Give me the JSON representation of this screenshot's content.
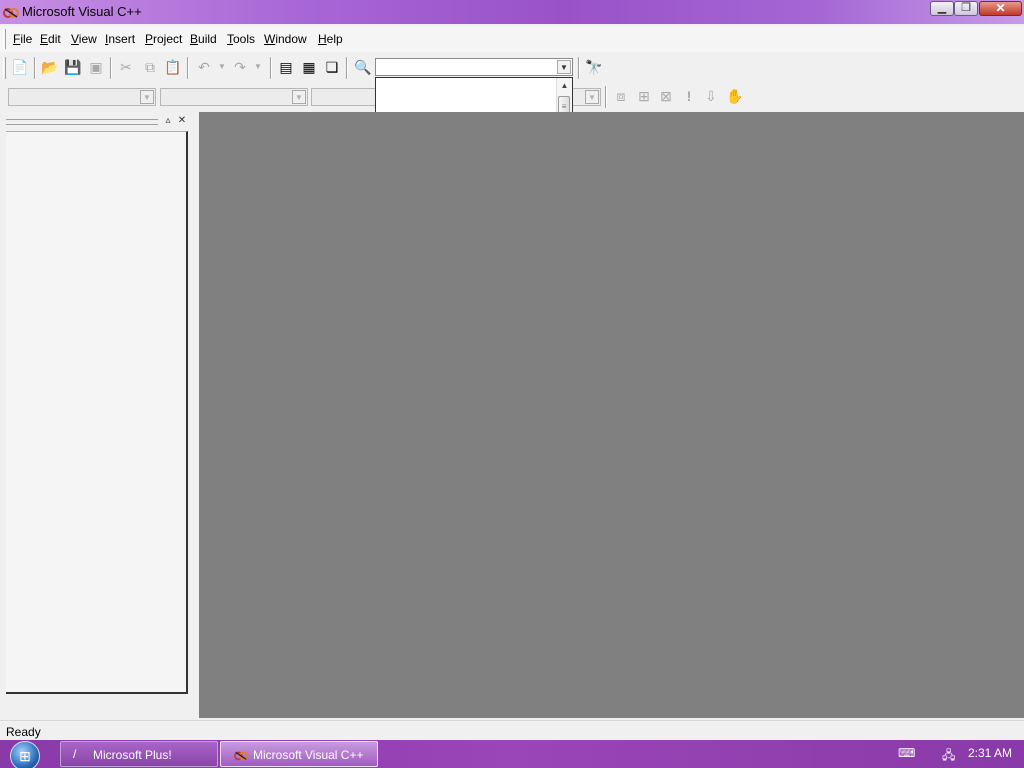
{
  "window": {
    "title": "Microsoft Visual C++"
  },
  "menu": {
    "items": [
      {
        "label": "File",
        "accel": "F",
        "rest": "ile"
      },
      {
        "label": "Edit",
        "accel": "E",
        "rest": "dit"
      },
      {
        "label": "View",
        "accel": "V",
        "rest": "iew"
      },
      {
        "label": "Insert",
        "accel": "I",
        "rest": "nsert"
      },
      {
        "label": "Project",
        "accel": "P",
        "rest": "roject"
      },
      {
        "label": "Build",
        "accel": "B",
        "rest": "uild"
      },
      {
        "label": "Tools",
        "accel": "T",
        "rest": "ools"
      },
      {
        "label": "Window",
        "accel": "W",
        "rest": "indow"
      },
      {
        "label": "Help",
        "accel": "H",
        "rest": "elp"
      }
    ]
  },
  "toolbar": {
    "standard_icons": [
      "new-text-file",
      "open",
      "save",
      "save-all",
      "cut",
      "copy",
      "paste",
      "undo",
      "redo",
      "workspace",
      "output",
      "window-list",
      "find-in-files",
      "find"
    ],
    "find_combo_value": "",
    "wizard_combos": [
      "",
      "",
      ""
    ],
    "build_icons": [
      "compile",
      "build",
      "stop-build",
      "execute",
      "go",
      "insert-remove-breakpoint"
    ]
  },
  "dropdown": {
    "options": [
      "",
      "",
      ""
    ],
    "selected_index": 1
  },
  "workspace_pane": {},
  "status": {
    "text": "Ready"
  },
  "taskbar": {
    "buttons": [
      {
        "label": "Microsoft Plus!",
        "active": false
      },
      {
        "label": "Microsoft Visual C++",
        "active": true
      }
    ],
    "clock": "2:31 AM"
  },
  "colors": {
    "title_gradient": "#a766d6",
    "selection": "#7a3f80",
    "mdi_background": "#808080",
    "taskbar": "#8a3aa8"
  }
}
